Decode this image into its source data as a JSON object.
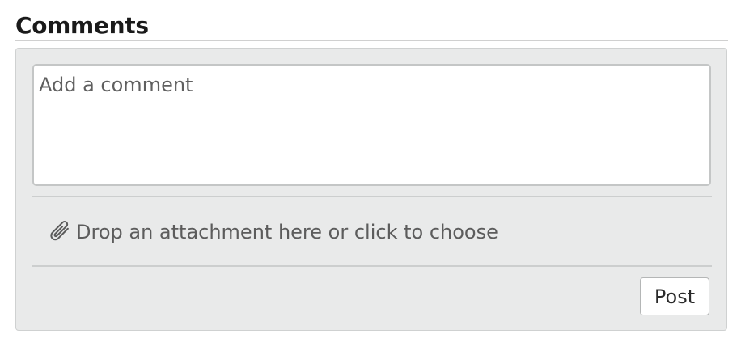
{
  "comments": {
    "title": "Comments",
    "comment_field": {
      "value": "",
      "placeholder": "Add a comment"
    },
    "attachment": {
      "icon": "paperclip-icon",
      "label": "Drop an attachment here or click to choose"
    },
    "post_button": {
      "label": "Post"
    }
  },
  "colors": {
    "panel_background": "#e9eaea",
    "panel_border": "#cfd1d1",
    "text_muted": "#5c5c5c",
    "heading": "#1a1a1a"
  }
}
